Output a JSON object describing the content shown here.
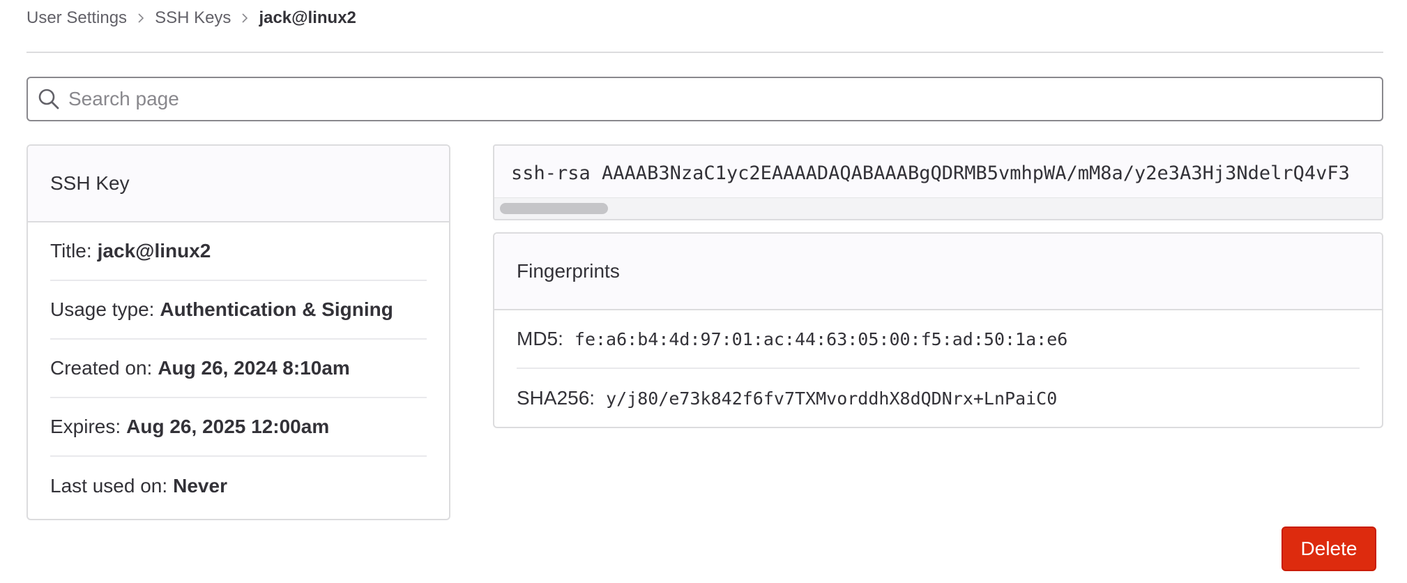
{
  "breadcrumb": {
    "items": [
      "User Settings",
      "SSH Keys"
    ],
    "current": "jack@linux2"
  },
  "search": {
    "placeholder": "Search page"
  },
  "ssh_key_card": {
    "header": "SSH Key",
    "rows": [
      {
        "label": "Title:",
        "value": "jack@linux2"
      },
      {
        "label": "Usage type:",
        "value": "Authentication & Signing"
      },
      {
        "label": "Created on:",
        "value": "Aug 26, 2024 8:10am"
      },
      {
        "label": "Expires:",
        "value": "Aug 26, 2025 12:00am"
      },
      {
        "label": "Last used on:",
        "value": "Never"
      }
    ]
  },
  "key_block": {
    "text": "ssh-rsa AAAAB3NzaC1yc2EAAAADAQABAAABgQDRMB5vmhpWA/mM8a/y2e3A3Hj3NdelrQ4vF3"
  },
  "fingerprints": {
    "header": "Fingerprints",
    "rows": [
      {
        "label": "MD5:",
        "value": "fe:a6:b4:4d:97:01:ac:44:63:05:00:f5:ad:50:1a:e6"
      },
      {
        "label": "SHA256:",
        "value": "y/j80/e73k842f6fv7TXMvorddhX8dQDNrx+LnPaiC0"
      }
    ]
  },
  "actions": {
    "delete_label": "Delete"
  },
  "colors": {
    "danger": "#dd2b0e",
    "border": "#dcdcde",
    "header_bg": "#fbfafd"
  },
  "icons": {
    "search": "search-icon",
    "separator": "chevron-right-icon"
  }
}
